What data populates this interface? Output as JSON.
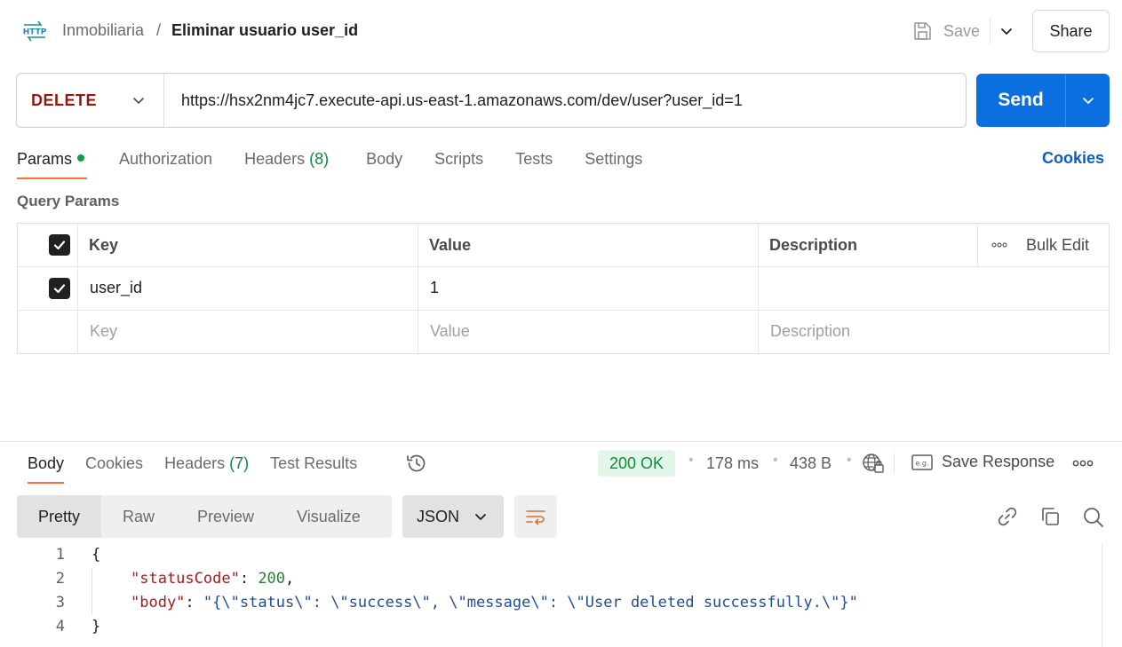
{
  "header": {
    "breadcrumb_parent": "Inmobiliaria",
    "breadcrumb_separator": "/",
    "request_name": "Eliminar usuario user_id",
    "save_label": "Save",
    "share_label": "Share"
  },
  "request": {
    "method": "DELETE",
    "url": "https://hsx2nm4jc7.execute-api.us-east-1.amazonaws.com/dev/user?user_id=1",
    "send_label": "Send"
  },
  "request_tabs": {
    "params": "Params",
    "authorization": "Authorization",
    "headers": "Headers",
    "headers_count": "(8)",
    "body": "Body",
    "scripts": "Scripts",
    "tests": "Tests",
    "settings": "Settings",
    "cookies": "Cookies"
  },
  "query_params": {
    "title": "Query Params",
    "col_key": "Key",
    "col_value": "Value",
    "col_description": "Description",
    "bulk_edit": "Bulk Edit",
    "rows": [
      {
        "key": "user_id",
        "value": "1",
        "description": "",
        "checked": true
      }
    ],
    "placeholder_key": "Key",
    "placeholder_value": "Value",
    "placeholder_description": "Description"
  },
  "response_tabs": {
    "body": "Body",
    "cookies": "Cookies",
    "headers": "Headers",
    "headers_count": "(7)",
    "test_results": "Test Results"
  },
  "response_meta": {
    "status": "200 OK",
    "time": "178 ms",
    "size": "438 B",
    "save_response": "Save Response"
  },
  "view_modes": {
    "pretty": "Pretty",
    "raw": "Raw",
    "preview": "Preview",
    "visualize": "Visualize",
    "format": "JSON"
  },
  "code": {
    "line_numbers": [
      "1",
      "2",
      "3",
      "4"
    ],
    "open_brace": "{",
    "close_brace": "}",
    "key1": "\"statusCode\"",
    "val1": "200",
    "key2": "\"body\"",
    "val2": "\"{\\\"status\\\": \\\"success\\\", \\\"message\\\": \\\"User deleted successfully.\\\"}\"",
    "colon": ": ",
    "comma": ","
  },
  "colors": {
    "primary": "#0c6fdf",
    "method": "#8e1a10",
    "active_tab_underline": "#ff6c37",
    "success": "#0b8a3c"
  }
}
